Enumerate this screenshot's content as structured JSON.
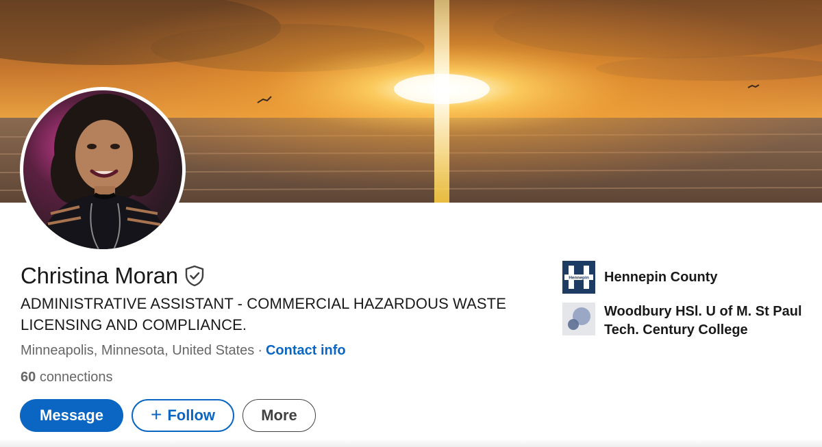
{
  "profile": {
    "name": "Christina Moran",
    "headline": "ADMINISTRATIVE ASSISTANT - COMMERCIAL HAZARDOUS WASTE LICENSING AND COMPLIANCE.",
    "location": "Minneapolis, Minnesota, United States",
    "separator": "·",
    "contact_info_label": "Contact info",
    "connections_count": "60",
    "connections_label": "connections",
    "verified_icon": "shield-check-icon"
  },
  "actions": {
    "message_label": "Message",
    "follow_plus": "+",
    "follow_label": "Follow",
    "more_label": "More"
  },
  "organizations": [
    {
      "name": "Hennepin County",
      "logo_text": "Hennepin",
      "logo_color": "#1d3b63"
    },
    {
      "name": "Woodbury HSl. U of M. St Paul Tech. Century College",
      "logo_color": "#d9dce3"
    }
  ],
  "colors": {
    "brand_blue": "#0a66c2",
    "text_primary": "#191919",
    "text_secondary": "#666666"
  }
}
